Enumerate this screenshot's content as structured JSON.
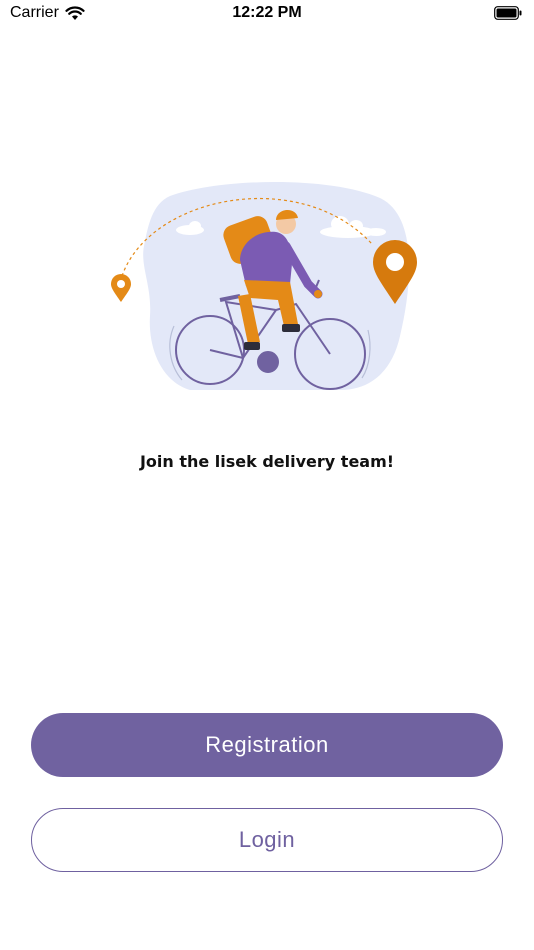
{
  "status_bar": {
    "carrier": "Carrier",
    "time": "12:22 PM",
    "icons": [
      "wifi-icon",
      "battery-icon"
    ]
  },
  "illustration": {
    "subject": "courier-on-bicycle",
    "icons": [
      "location-pin-icon",
      "cloud-icon",
      "bicycle-icon"
    ]
  },
  "tagline": "Join the lisek delivery team!",
  "actions": {
    "registration_label": "Registration",
    "login_label": "Login"
  },
  "colors": {
    "primary": "#7062a0",
    "accent_orange": "#e48a17",
    "blob": "#e3e8f8",
    "background": "#ffffff"
  }
}
